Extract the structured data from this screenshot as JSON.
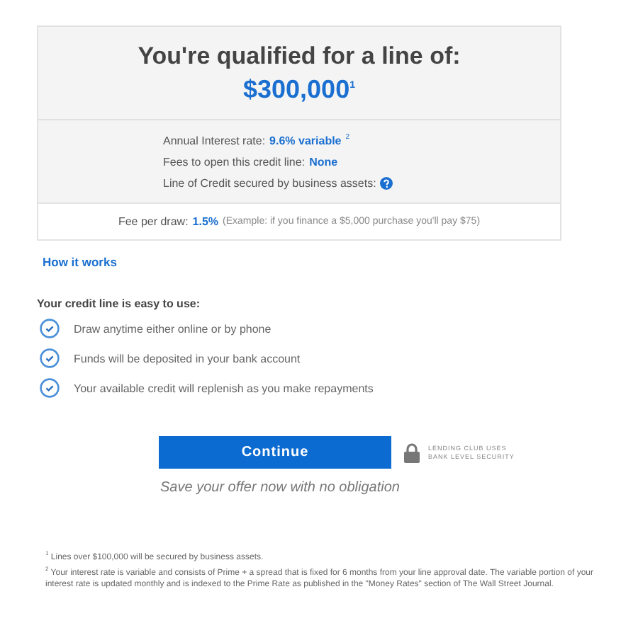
{
  "offer": {
    "heading": "You're qualified for a line of:",
    "amount": "$300,000$^{1}$",
    "details": [
      {
        "label": "Annual Interest rate:",
        "value": "9.6% variable",
        "note": "2",
        "kind": "text"
      },
      {
        "label": "Fees to open this credit line:",
        "value": "None",
        "kind": "text"
      },
      {
        "label": "Line of Credit secured by business assets:",
        "kind": "help"
      }
    ],
    "fee": {
      "label": "Fee per draw:",
      "value": "1.5%",
      "example": "(Example: if you finance a $5,000 purchase you'll pay $75)"
    }
  },
  "how_link": "How it works",
  "benefits": {
    "title": "Your credit line is easy to use:",
    "items": [
      "Draw anytime either online or by phone",
      "Funds will be deposited in your bank account",
      "Your available credit will replenish as you make repayments"
    ]
  },
  "continue_button": "Continue",
  "security": [
    "LENDING CLUB USES",
    "BANK LEVEL SECURITY"
  ],
  "save_note": "Save your offer now with no obligation",
  "footnotes": [
    "$^{1}$ Lines over $100,000 will be secured by business assets.",
    "$^{2}$ Your interest rate is variable and consists of Prime + a spread that is fixed for 6 months from your line approval date. The variable portion of your interest rate is updated monthly and is indexed to the Prime Rate as published in the \"Money Rates\" section of The Wall Street Journal."
  ]
}
